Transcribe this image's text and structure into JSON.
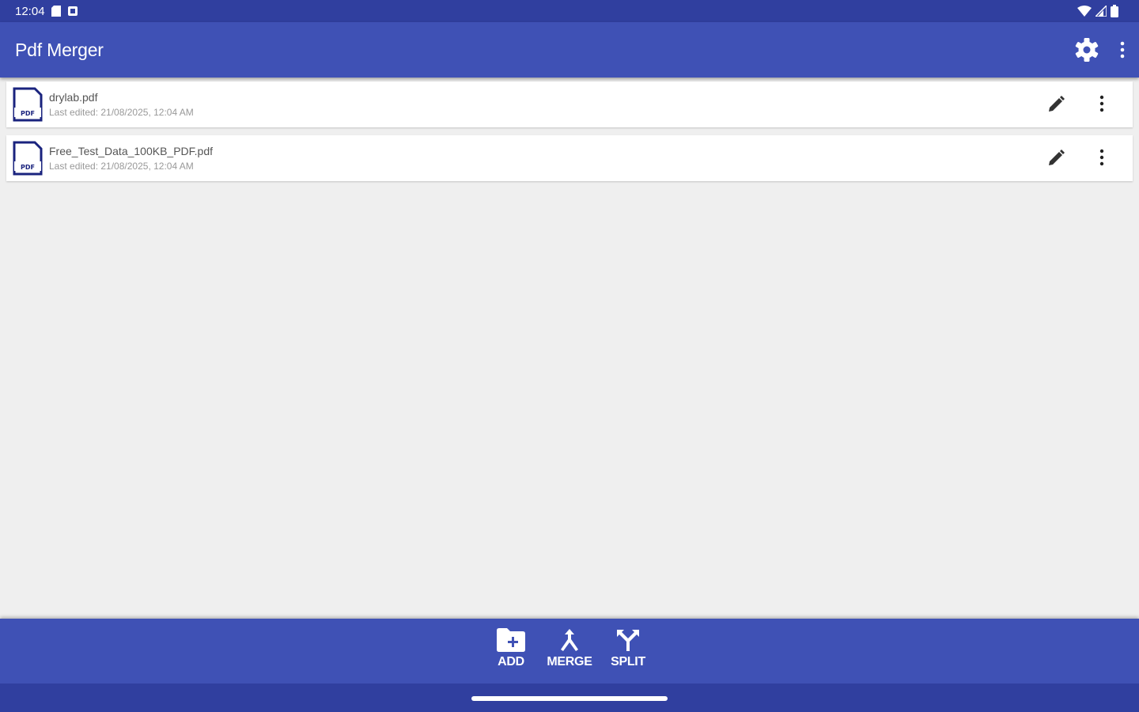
{
  "status_bar": {
    "time": "12:04"
  },
  "app_bar": {
    "title": "Pdf Merger"
  },
  "files": [
    {
      "name": "drylab.pdf",
      "meta": "Last edited: 21/08/2025, 12:04 AM",
      "thumb_label": "PDF"
    },
    {
      "name": "Free_Test_Data_100KB_PDF.pdf",
      "meta": "Last edited: 21/08/2025, 12:04 AM",
      "thumb_label": "PDF"
    }
  ],
  "bottom_bar": {
    "add_label": "ADD",
    "merge_label": "MERGE",
    "split_label": "SPLIT"
  },
  "colors": {
    "primary": "#3f51b5",
    "primary_dark": "#303f9f",
    "background": "#efefef",
    "pdf_icon": "#1a237e"
  }
}
